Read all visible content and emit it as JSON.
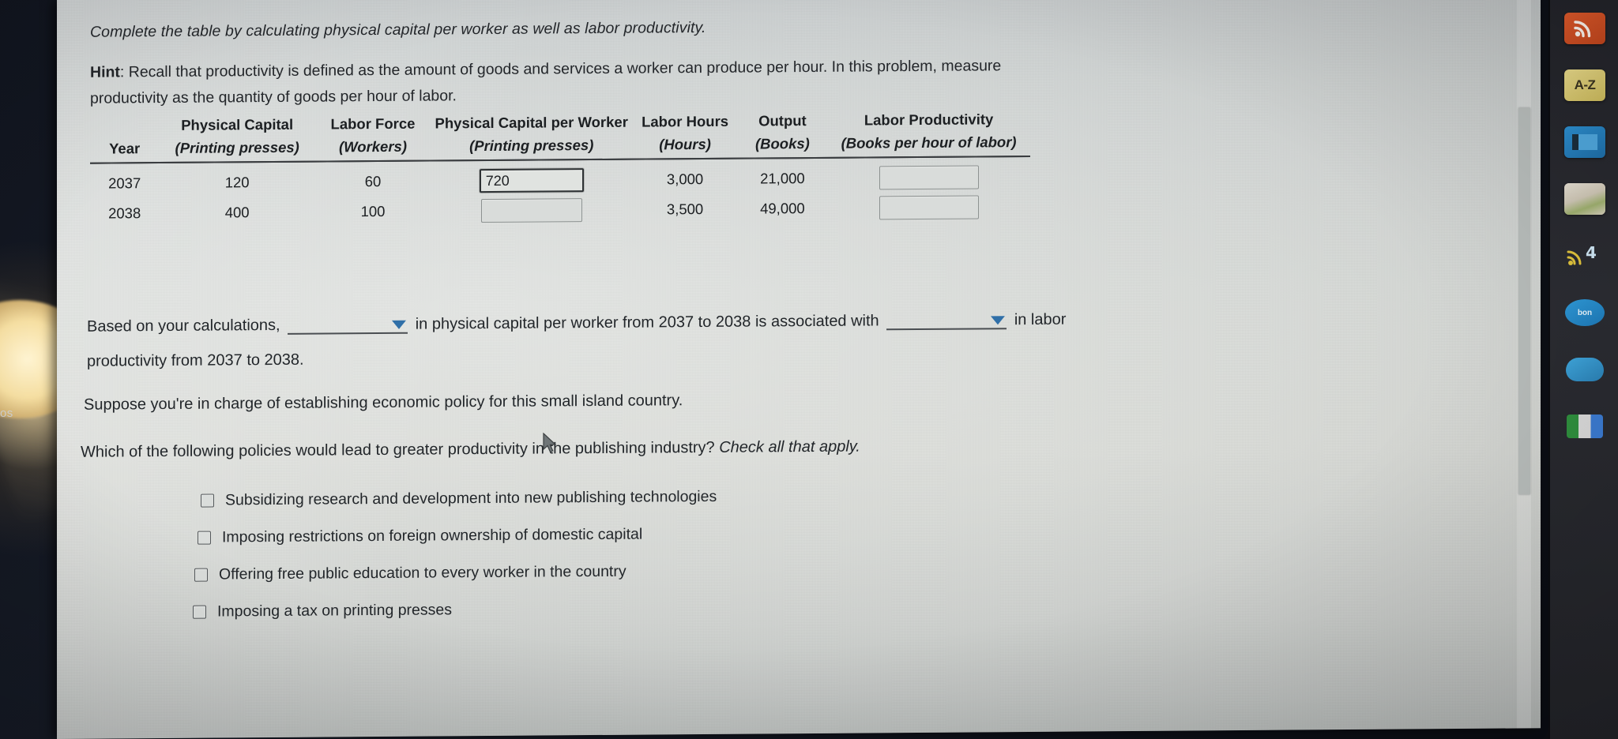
{
  "prompt": {
    "instruction": "Complete the table by calculating physical capital per worker as well as labor productivity.",
    "hint_label": "Hint",
    "hint_text": ": Recall that productivity is defined as the amount of goods and services a worker can produce per hour. In this problem, measure productivity as the quantity of goods per hour of labor."
  },
  "table": {
    "headers_top": [
      "",
      "Physical Capital",
      "Labor Force",
      "Physical Capital per Worker",
      "Labor Hours",
      "Output",
      "Labor Productivity"
    ],
    "headers_sub": [
      "Year",
      "(Printing presses)",
      "(Workers)",
      "(Printing presses)",
      "(Hours)",
      "(Books)",
      "(Books per hour of labor)"
    ],
    "rows": [
      {
        "year": "2037",
        "physical_capital": "120",
        "labor_force": "60",
        "capital_per_worker": "720",
        "labor_hours": "3,000",
        "output": "21,000",
        "labor_productivity": ""
      },
      {
        "year": "2038",
        "physical_capital": "400",
        "labor_force": "100",
        "capital_per_worker": "",
        "labor_hours": "3,500",
        "output": "49,000",
        "labor_productivity": ""
      }
    ]
  },
  "sentence": {
    "part1": "Based on your calculations,",
    "dropdown1_value": "",
    "part2": "in physical capital per worker from 2037 to 2038 is associated with",
    "dropdown2_value": "",
    "part3": "in labor",
    "part4": "productivity from 2037 to 2038."
  },
  "paragraphs": {
    "suppose": "Suppose you're in charge of establishing economic policy for this small island country.",
    "which_main": "Which of the following policies would lead to greater productivity in the publishing industry? ",
    "which_italic": "Check all that apply."
  },
  "options": [
    {
      "label": "Subsidizing research and development into new publishing technologies",
      "checked": false
    },
    {
      "label": "Imposing restrictions on foreign ownership of domestic capital",
      "checked": false
    },
    {
      "label": "Offering free public education to every worker in the country",
      "checked": false
    },
    {
      "label": "Imposing a tax on printing presses",
      "checked": false
    }
  ],
  "desktop": {
    "wallpaper_text": "os",
    "dock_icons": [
      {
        "name": "rss-icon",
        "label": ""
      },
      {
        "name": "dictionary-a-z-icon",
        "label": "A-Z"
      },
      {
        "name": "book-icon",
        "label": ""
      },
      {
        "name": "photos-icon",
        "label": ""
      },
      {
        "name": "wifi-icon",
        "label": ""
      },
      {
        "name": "blue-app-icon",
        "label": "bon"
      },
      {
        "name": "cloud-icon",
        "label": ""
      },
      {
        "name": "colored-app-icon",
        "label": ""
      }
    ]
  },
  "colors": {
    "dropdown_caret": "#2f6fa8",
    "page_background": "#d9dcd9",
    "text": "#22262a"
  }
}
